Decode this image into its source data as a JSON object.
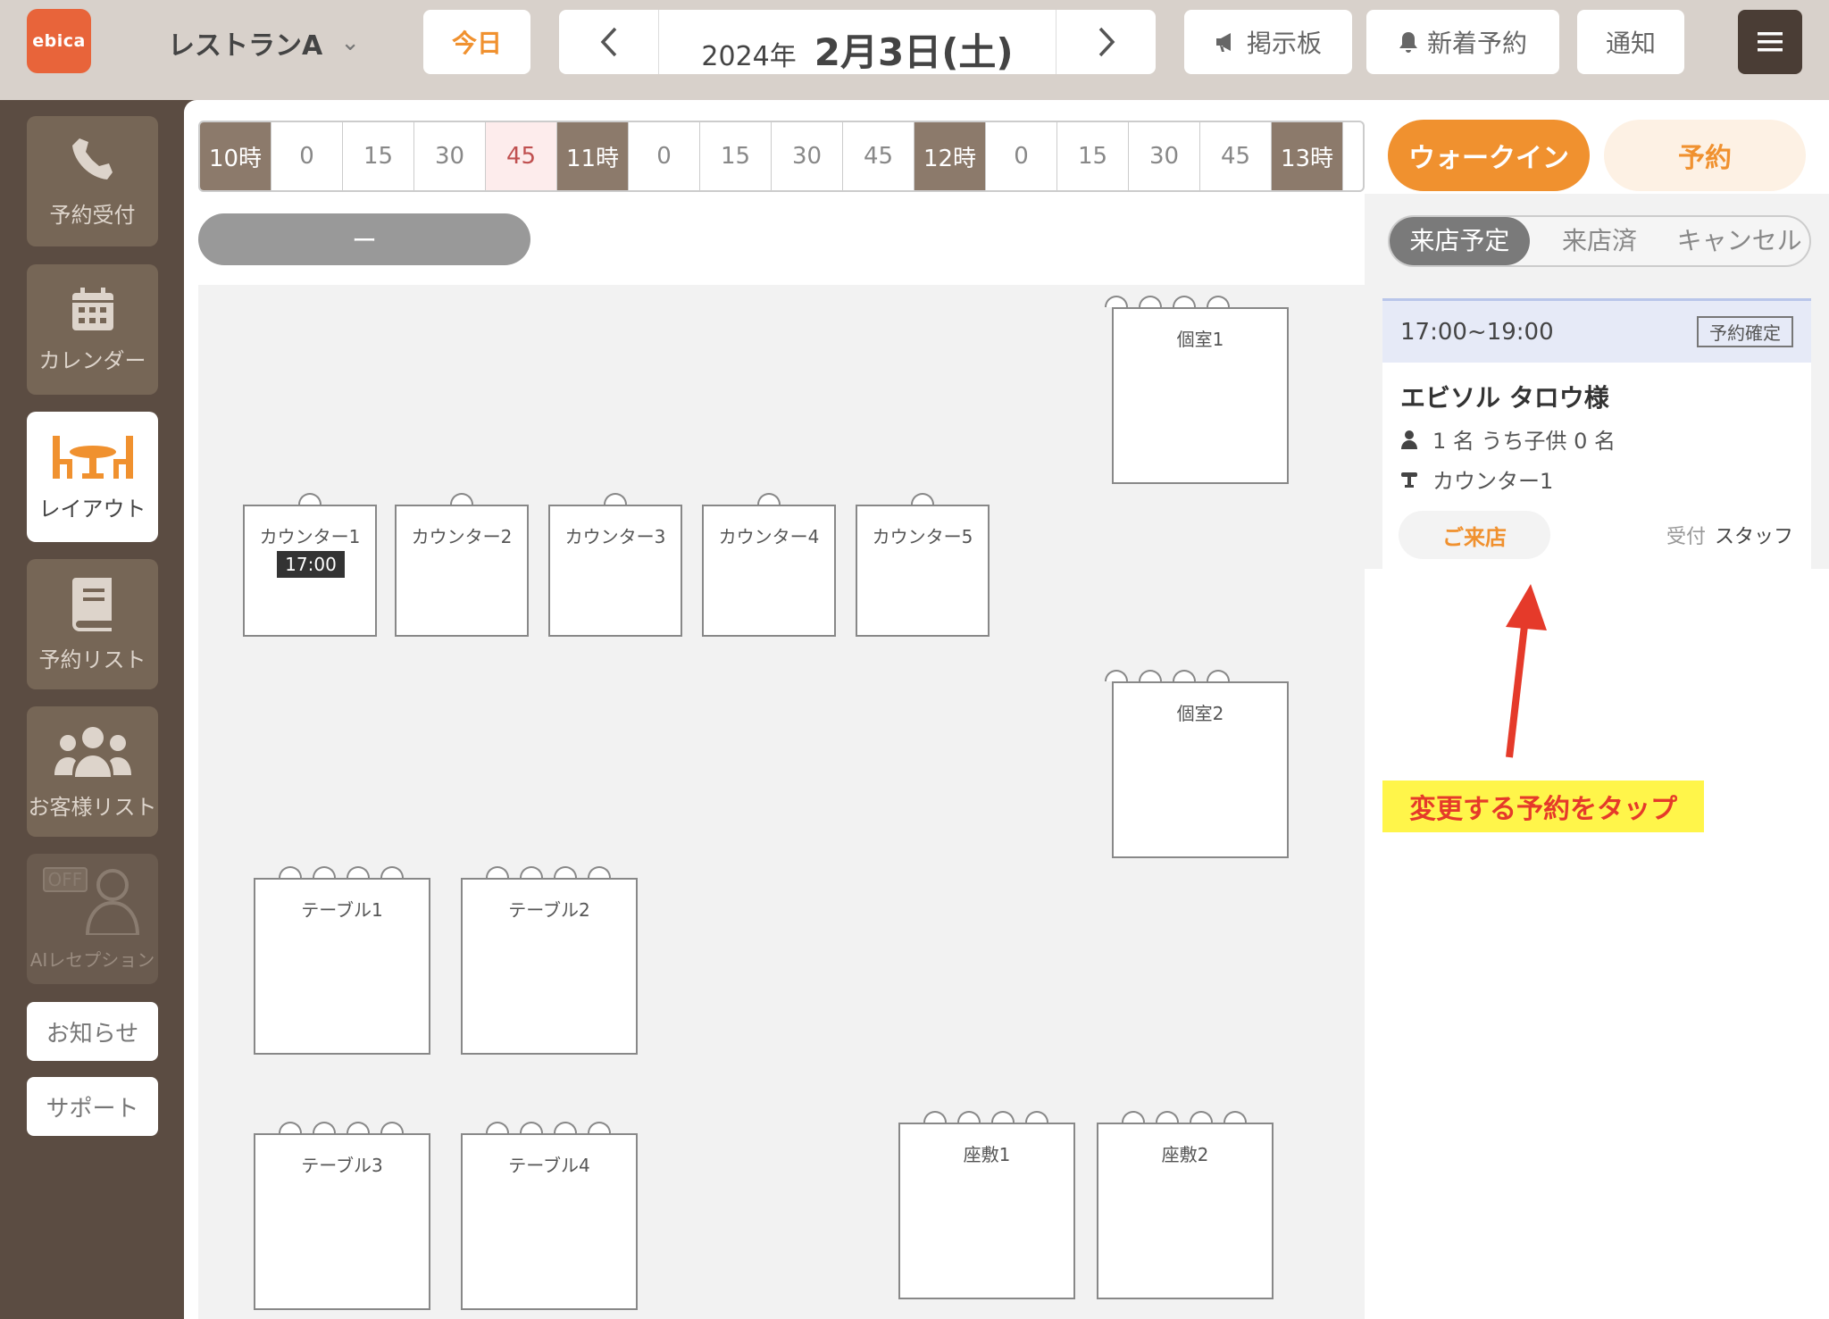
{
  "header": {
    "logo": "ebica",
    "store_name": "レストランA",
    "today_label": "今日",
    "date_year": "2024年",
    "date_monthday": "2月3日(土)",
    "board_label": "掲示板",
    "new_reservation_label": "新着予約",
    "notification_label": "通知"
  },
  "sidebar": {
    "items": [
      {
        "label": "予約受付",
        "icon": "phone-icon"
      },
      {
        "label": "カレンダー",
        "icon": "calendar-icon"
      },
      {
        "label": "レイアウト",
        "icon": "table-layout-icon"
      },
      {
        "label": "予約リスト",
        "icon": "book-icon"
      },
      {
        "label": "お客様リスト",
        "icon": "users-icon"
      },
      {
        "label": "AIレセプション",
        "icon": "ai-receptionist-icon",
        "badge": "OFF"
      }
    ],
    "news_label": "お知らせ",
    "support_label": "サポート"
  },
  "timeline": [
    "10時",
    "0",
    "15",
    "30",
    "45",
    "11時",
    "0",
    "15",
    "30",
    "45",
    "12時",
    "0",
    "15",
    "30",
    "45",
    "13時"
  ],
  "filter_pill": "ー",
  "floor": {
    "private_room_1": "個室1",
    "private_room_2": "個室2",
    "counters": [
      "カウンター1",
      "カウンター2",
      "カウンター3",
      "カウンター4",
      "カウンター5"
    ],
    "counter1_badge": "17:00",
    "tables": [
      "テーブル1",
      "テーブル2",
      "テーブル3",
      "テーブル4"
    ],
    "zashiki": [
      "座敷1",
      "座敷2"
    ]
  },
  "right_panel": {
    "walkin_label": "ウォークイン",
    "reserve_label": "予約",
    "tabs": [
      "来店予定",
      "来店済",
      "キャンセル"
    ],
    "card": {
      "time": "17:00~19:00",
      "status": "予約確定",
      "name": "エビソル タロウ様",
      "people": "1 名 うち子供 0 名",
      "seat": "カウンター1",
      "visit_label": "ご来店",
      "received_label": "受付",
      "staff": "スタッフ"
    },
    "annotation": "変更する予約をタップ"
  },
  "colors": {
    "accent": "#f0912f",
    "brand": "#e8643a",
    "sidebar_bg": "#5b4c42",
    "annotation_bg": "#fff54a",
    "annotation_text": "#e53a2a"
  }
}
